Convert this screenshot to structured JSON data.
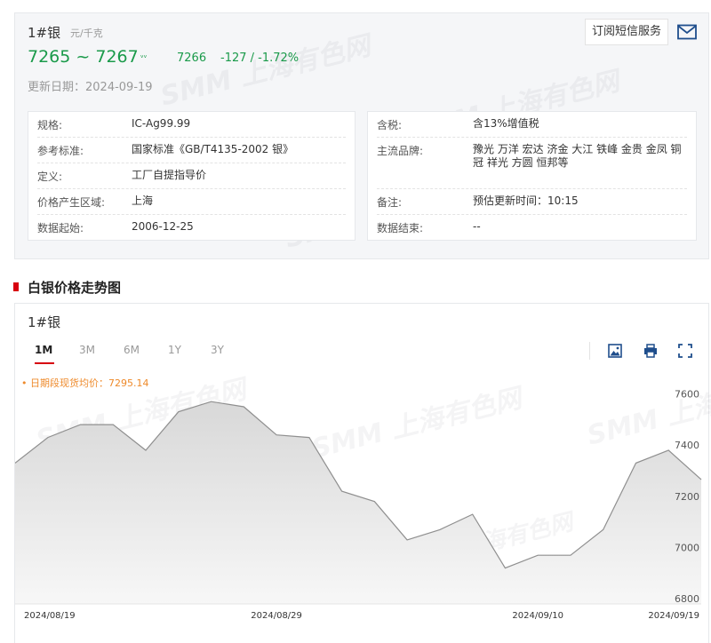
{
  "product": {
    "name": "1#银",
    "unit": "元/千克",
    "price_range": "7265 ~ 7267",
    "avg_price": "7266",
    "change": "-127 / -1.72%",
    "update_date": "更新日期：2024-09-19",
    "subscribe_label": "订阅短信服务",
    "icons": {
      "mail": "mail-icon",
      "trend": "trend-down-icon"
    },
    "colors": {
      "down": "#1a9a4a",
      "accent": "#d7000f"
    }
  },
  "specs_left": [
    {
      "key": "规格:",
      "value": "IC-Ag99.99"
    },
    {
      "key": "参考标准:",
      "value": "国家标准《GB/T4135-2002 银》"
    },
    {
      "key": "定义:",
      "value": "工厂自提指导价"
    },
    {
      "key": "价格产生区域:",
      "value": "上海"
    },
    {
      "key": "数据起始:",
      "value": "2006-12-25"
    }
  ],
  "specs_right": [
    {
      "key": "含税:",
      "value": "含13%增值税"
    },
    {
      "key": "主流品牌:",
      "value": "豫光 万洋 宏达 济金 大江 铁峰 金贵 金凤 铜冠 祥光 方圆 恒邦等"
    },
    {
      "key": "备注:",
      "value": "预估更新时间：10:15"
    },
    {
      "key": "数据结束:",
      "value": "--"
    }
  ],
  "section_title": "白银价格走势图",
  "watermark": "SMM 上海有色网",
  "chart": {
    "title": "1#银",
    "tabs": [
      {
        "label": "1M",
        "active": true
      },
      {
        "label": "3M",
        "active": false
      },
      {
        "label": "6M",
        "active": false
      },
      {
        "label": "1Y",
        "active": false
      },
      {
        "label": "3Y",
        "active": false
      }
    ],
    "legend": "• 日期段现货均价：7295.14",
    "tool_icons": [
      "image-download-icon",
      "print-icon",
      "fullscreen-icon"
    ]
  },
  "chart_data": {
    "type": "area",
    "x": [
      "2024/08/19",
      "2024/08/20",
      "2024/08/21",
      "2024/08/22",
      "2024/08/23",
      "2024/08/26",
      "2024/08/27",
      "2024/08/28",
      "2024/08/29",
      "2024/08/30",
      "2024/09/02",
      "2024/09/03",
      "2024/09/04",
      "2024/09/05",
      "2024/09/06",
      "2024/09/09",
      "2024/09/10",
      "2024/09/11",
      "2024/09/12",
      "2024/09/13",
      "2024/09/18",
      "2024/09/19"
    ],
    "values": [
      7330,
      7430,
      7480,
      7480,
      7380,
      7530,
      7570,
      7550,
      7440,
      7430,
      7220,
      7180,
      7030,
      7070,
      7130,
      6920,
      6970,
      6970,
      7070,
      7330,
      7380,
      7266
    ],
    "x_tick_labels": [
      "2024/08/19",
      "2024/08/29",
      "2024/09/10",
      "2024/09/19"
    ],
    "y_ticks": [
      6800,
      7000,
      7200,
      7400,
      7600
    ],
    "ylim": [
      6780,
      7640
    ],
    "xlabel": "",
    "ylabel": "",
    "grid": false,
    "colors": {
      "line": "#8f8f8f",
      "fill_top": "#d8d8d8",
      "fill_bottom": "#f7f7f7"
    }
  }
}
